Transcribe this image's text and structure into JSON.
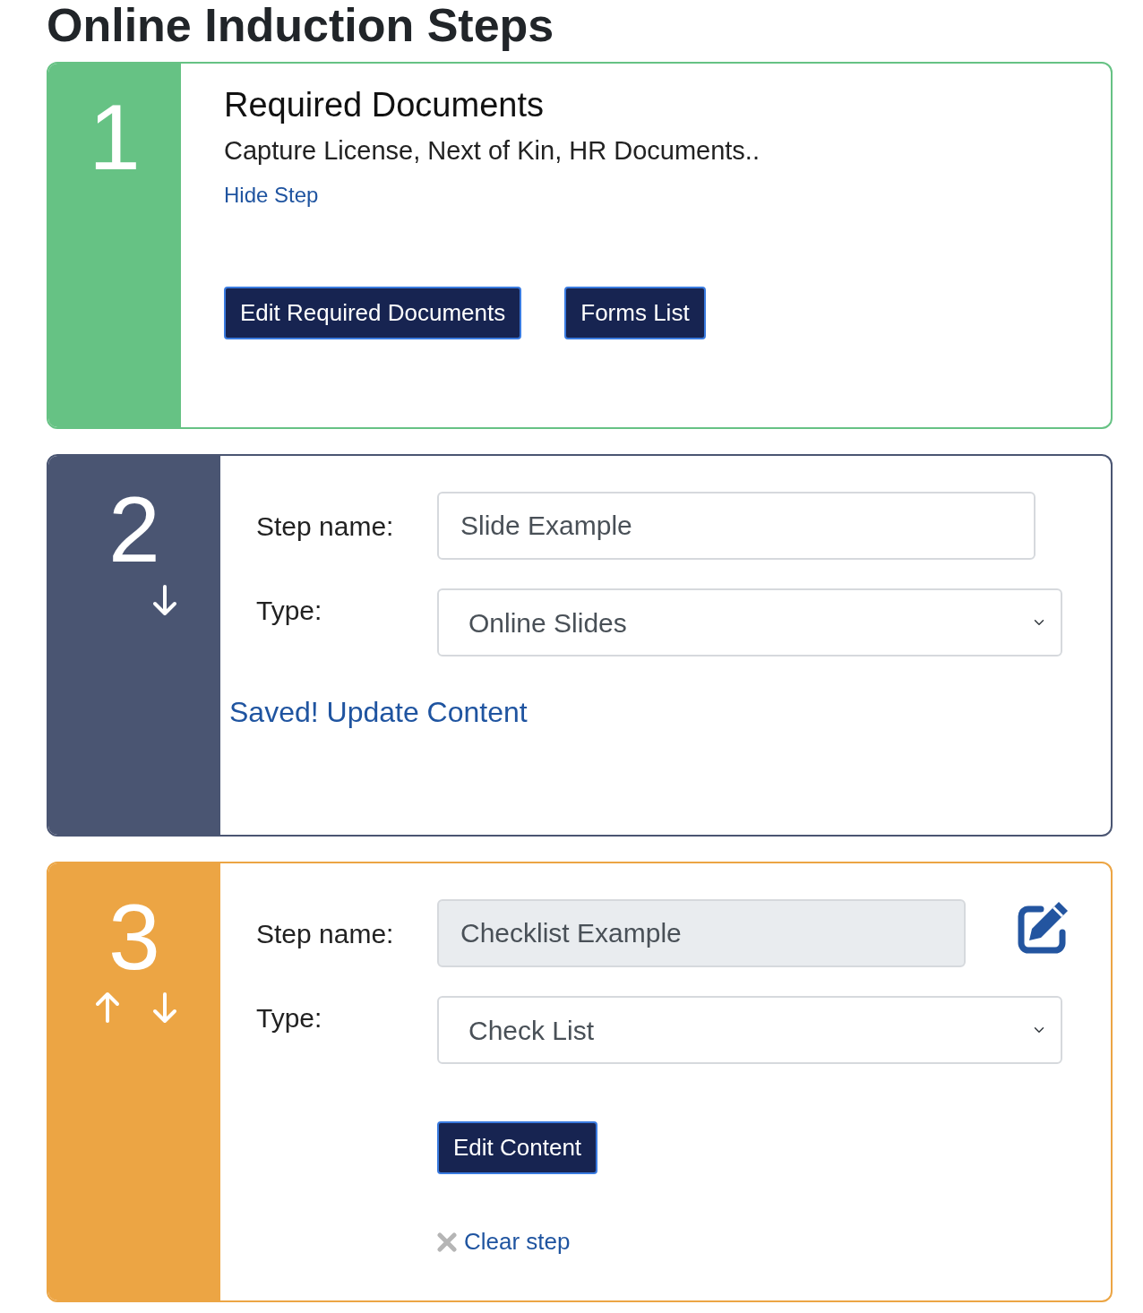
{
  "title": "Online Induction Steps",
  "steps": [
    {
      "kind": "documents",
      "number": "1",
      "color": "#66c284",
      "title": "Required Documents",
      "description": "Capture License, Next of Kin, HR Documents..",
      "link": "Hide Step",
      "buttons": [
        "Edit Required Documents",
        "Forms List"
      ]
    },
    {
      "kind": "editor",
      "number": "2",
      "color": "#4a5572",
      "move_up": false,
      "move_down": true,
      "name_label": "Step name:",
      "name_value": "Slide Example",
      "name_disabled": false,
      "type_label": "Type:",
      "type_value": "Online Slides",
      "status_link": "Saved! Update Content"
    },
    {
      "kind": "editor",
      "number": "3",
      "color": "#eca544",
      "move_up": true,
      "move_down": true,
      "name_label": "Step name:",
      "name_value": "Checklist Example",
      "name_disabled": true,
      "edit_icon": true,
      "type_label": "Type:",
      "type_value": "Check List",
      "button": "Edit Content",
      "clear_link": "Clear step"
    }
  ]
}
